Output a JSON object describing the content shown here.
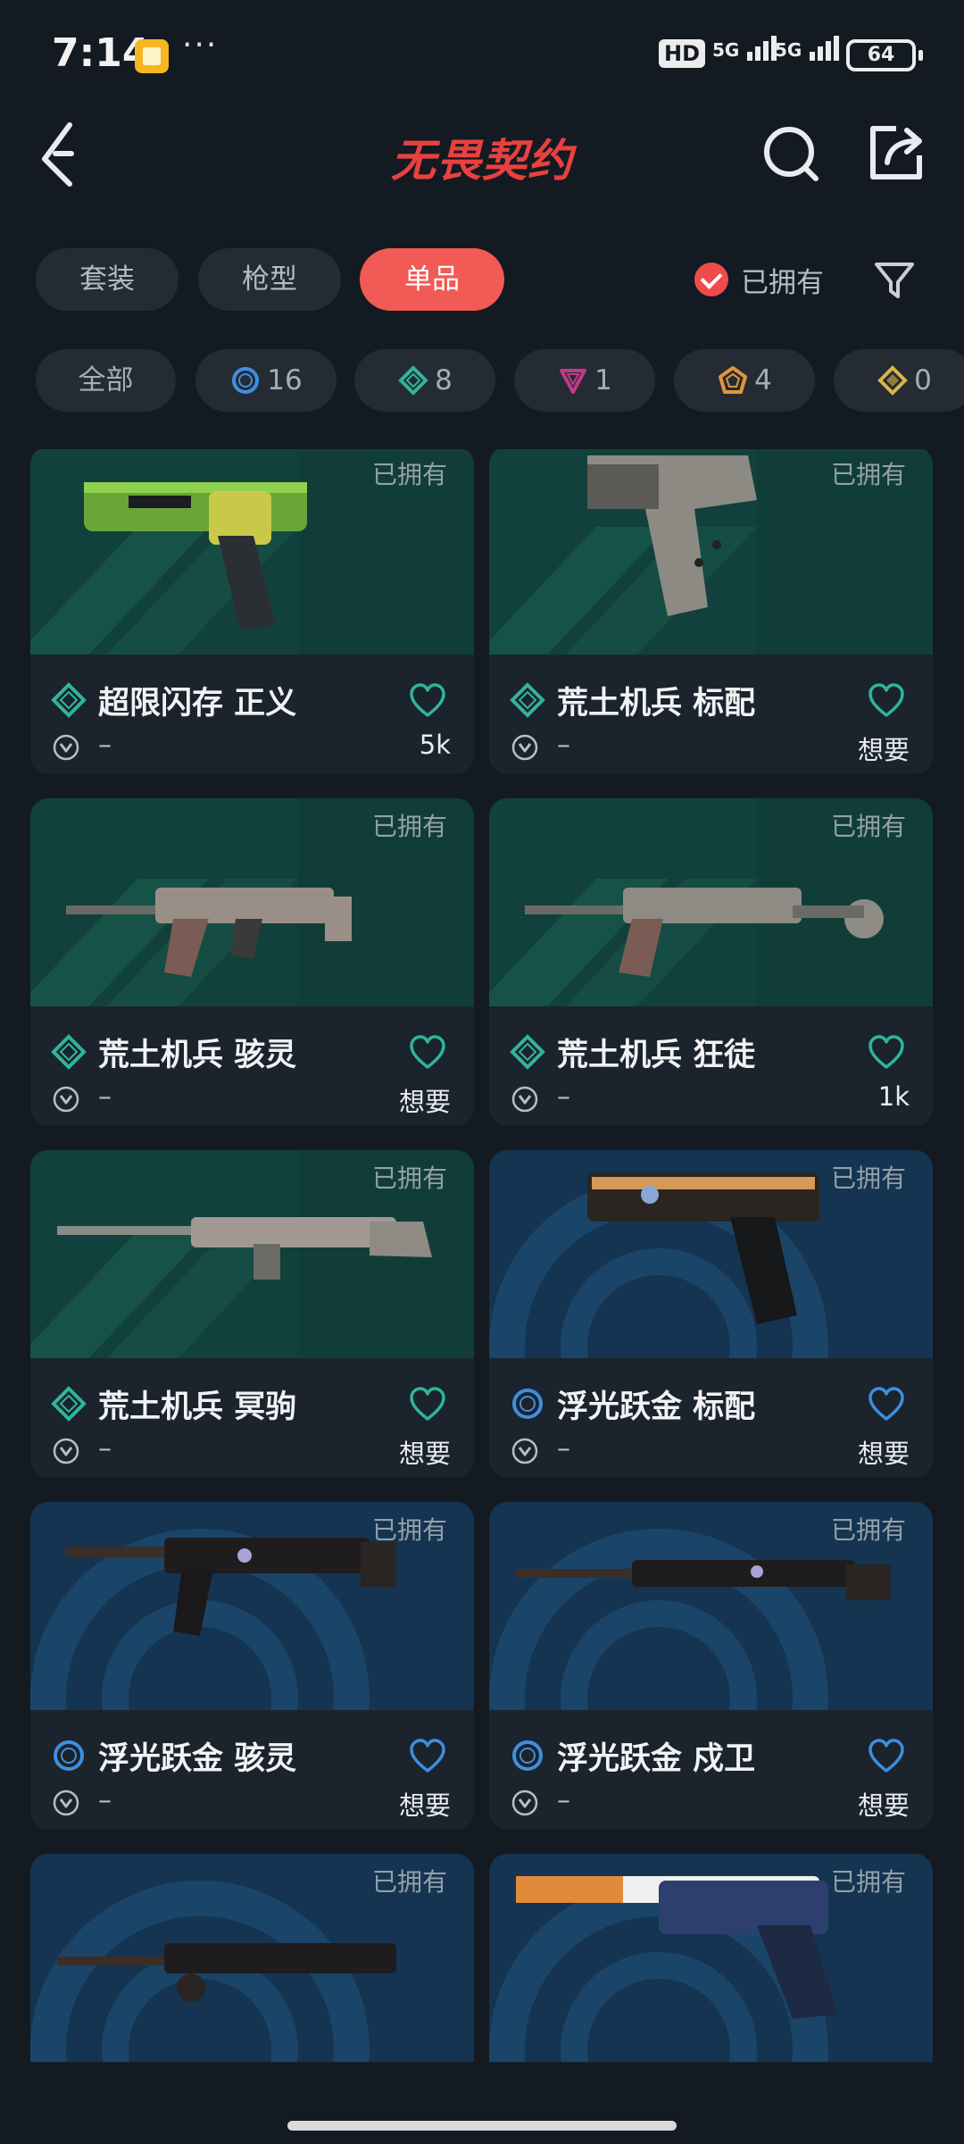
{
  "status_bar": {
    "time": "7:14",
    "dots": "···",
    "hd_badge": "HD",
    "net1": "5G",
    "net2": "5G",
    "battery": "64"
  },
  "header": {
    "logo_text": "无畏契约",
    "logo_color": "#e8413f"
  },
  "tabs": [
    {
      "label": "套装",
      "active": false
    },
    {
      "label": "枪型",
      "active": false
    },
    {
      "label": "单品",
      "active": true
    }
  ],
  "owned_filter": {
    "label": "已拥有",
    "checked": true
  },
  "rarity_chips": [
    {
      "label": "全部",
      "icon": "none"
    },
    {
      "label": "16",
      "icon": "ring-icon",
      "color": "#3d8fe0"
    },
    {
      "label": "8",
      "icon": "diamond-icon",
      "color": "#2fb59c"
    },
    {
      "label": "1",
      "icon": "triangle-icon",
      "color": "#c0398a"
    },
    {
      "label": "4",
      "icon": "pentagon-icon",
      "color": "#e0963a"
    },
    {
      "label": "0",
      "icon": "diamond-gold-icon",
      "color": "#d9b54a"
    }
  ],
  "items": [
    {
      "name": "超限闪存 正义",
      "owned_tag": "已拥有",
      "tier": "diamond",
      "bg": "green",
      "sub": "–",
      "want": "5k",
      "heart_color": "#2fb59c"
    },
    {
      "name": "荒土机兵 标配",
      "owned_tag": "已拥有",
      "tier": "diamond",
      "bg": "green",
      "sub": "–",
      "want": "想要",
      "heart_color": "#2fb59c"
    },
    {
      "name": "荒土机兵 骇灵",
      "owned_tag": "已拥有",
      "tier": "diamond",
      "bg": "green",
      "sub": "–",
      "want": "想要",
      "heart_color": "#2fb59c"
    },
    {
      "name": "荒土机兵 狂徒",
      "owned_tag": "已拥有",
      "tier": "diamond",
      "bg": "green",
      "sub": "–",
      "want": "1k",
      "heart_color": "#2fb59c"
    },
    {
      "name": "荒土机兵 冥驹",
      "owned_tag": "已拥有",
      "tier": "diamond",
      "bg": "green",
      "sub": "–",
      "want": "想要",
      "heart_color": "#2fb59c"
    },
    {
      "name": "浮光跃金 标配",
      "owned_tag": "已拥有",
      "tier": "ring",
      "bg": "blue",
      "sub": "–",
      "want": "想要",
      "heart_color": "#3d8fe0"
    },
    {
      "name": "浮光跃金 骇灵",
      "owned_tag": "已拥有",
      "tier": "ring",
      "bg": "blue",
      "sub": "–",
      "want": "想要",
      "heart_color": "#3d8fe0"
    },
    {
      "name": "浮光跃金 戍卫",
      "owned_tag": "已拥有",
      "tier": "ring",
      "bg": "blue",
      "sub": "–",
      "want": "想要",
      "heart_color": "#3d8fe0"
    },
    {
      "name": "",
      "owned_tag": "已拥有",
      "tier": "ring",
      "bg": "blue",
      "sub": "",
      "want": "",
      "heart_color": "#3d8fe0"
    },
    {
      "name": "",
      "owned_tag": "已拥有",
      "tier": "ring",
      "bg": "blue",
      "sub": "",
      "want": "",
      "heart_color": "#3d8fe0"
    }
  ]
}
